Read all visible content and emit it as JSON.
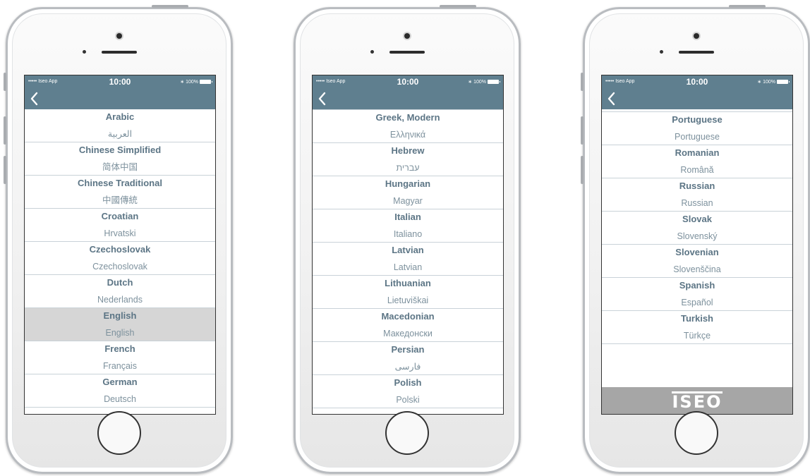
{
  "status_bar": {
    "carrier": "••••• Iseo App",
    "time": "10:00",
    "battery": "100%"
  },
  "footer_logo": "ISEO",
  "screens": [
    {
      "items": [
        {
          "name": "Arabic",
          "native": "العربية"
        },
        {
          "name": "Chinese Simplified",
          "native": "简体中国"
        },
        {
          "name": "Chinese Traditional",
          "native": "中國傳統"
        },
        {
          "name": "Croatian",
          "native": "Hrvatski"
        },
        {
          "name": "Czechoslovak",
          "native": "Czechoslovak"
        },
        {
          "name": "Dutch",
          "native": "Nederlands"
        },
        {
          "name": "English",
          "native": "English",
          "selected": true
        },
        {
          "name": "French",
          "native": "Français"
        },
        {
          "name": "German",
          "native": "Deutsch"
        }
      ]
    },
    {
      "items": [
        {
          "name": "Greek, Modern",
          "native": "Ελληνικά"
        },
        {
          "name": "Hebrew",
          "native": "עברית"
        },
        {
          "name": "Hungarian",
          "native": "Magyar"
        },
        {
          "name": "Italian",
          "native": "Italiano"
        },
        {
          "name": "Latvian",
          "native": "Latvian"
        },
        {
          "name": "Lithuanian",
          "native": "Lietuviškai"
        },
        {
          "name": "Macedonian",
          "native": "Македонски"
        },
        {
          "name": "Persian",
          "native": "فارسی"
        },
        {
          "name": "Polish",
          "native": "Polski"
        }
      ]
    },
    {
      "items": [
        {
          "name": "Portuguese",
          "native": "Portuguese"
        },
        {
          "name": "Romanian",
          "native": "Română"
        },
        {
          "name": "Russian",
          "native": "Russian"
        },
        {
          "name": "Slovak",
          "native": "Slovenský"
        },
        {
          "name": "Slovenian",
          "native": "Slovenščina"
        },
        {
          "name": "Spanish",
          "native": "Español"
        },
        {
          "name": "Turkish",
          "native": "Türkçe"
        }
      ]
    }
  ]
}
